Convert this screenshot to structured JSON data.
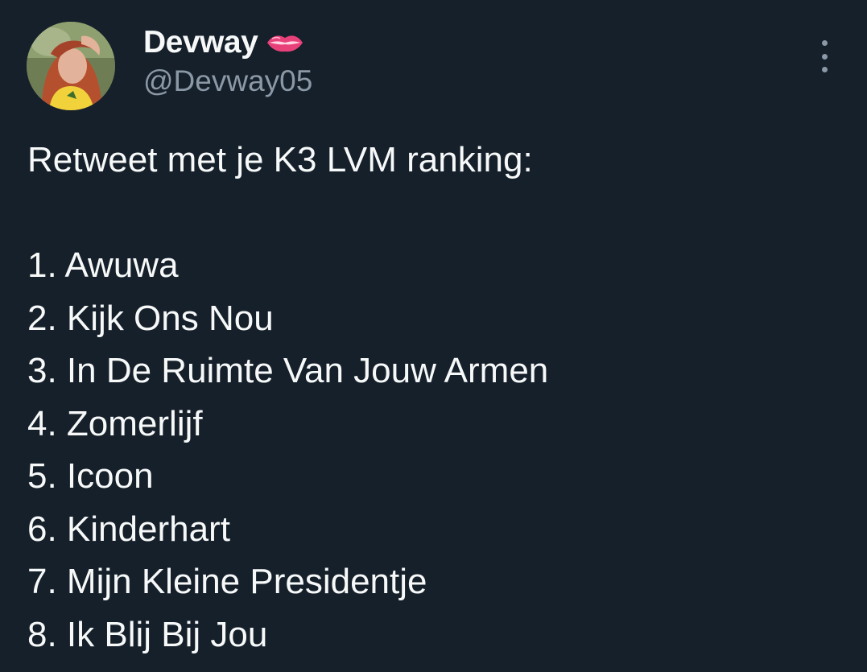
{
  "author": {
    "display_name": "Devway",
    "handle": "@Devway05",
    "emoji_icon": "lips-icon",
    "avatar_icon": "profile-photo"
  },
  "tweet": {
    "intro": "Retweet met je K3 LVM ranking:",
    "ranking": [
      "1. Awuwa",
      "2. Kijk Ons Nou",
      "3. In De Ruimte Van Jouw Armen",
      "4. Zomerlijf",
      "5. Icoon",
      "6. Kinderhart",
      "7. Mijn Kleine Presidentje",
      "8. Ik Blij Bij Jou"
    ]
  },
  "actions": {
    "more_icon": "more-vertical-icon"
  },
  "colors": {
    "background": "#15202b",
    "text_primary": "#f7f9f9",
    "text_secondary": "#8b98a5",
    "lips": "#e8417a"
  }
}
